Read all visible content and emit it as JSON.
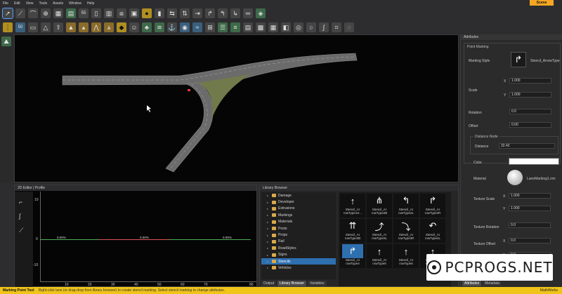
{
  "menubar": {
    "items": [
      "File",
      "Edit",
      "View",
      "Tools",
      "Assets",
      "Window",
      "Help"
    ],
    "scene_badge": "Scene"
  },
  "toolbar_row1_icons": [
    "select-arrow",
    "road-tool",
    "road-curve",
    "road-junction",
    "crosswalk",
    "building",
    "sign-55",
    "sign-blank",
    "barrier",
    "fence",
    "trafficlight-box",
    "trafficlight",
    "bus-stop",
    "arrow-left-right",
    "arrow-up-down",
    "truck",
    "arrow-right",
    "marking-left",
    "marking-right",
    "stop-line",
    "sign-green"
  ],
  "toolbar_row2_icons": [
    "lane-marking",
    "sign-50",
    "speed-hump",
    "triangle-sign",
    "direction-sign",
    "cone",
    "cones",
    "cones-row",
    "traffic-cone-3",
    "barrier-yellow",
    "person",
    "tree",
    "grass",
    "anchor",
    "camera",
    "water",
    "signal-road",
    "stack",
    "layers",
    "book",
    "pattern",
    "ground",
    "object",
    "disc",
    "ring",
    "curve-road",
    "road-mesh",
    "circle-tool"
  ],
  "left_strip": {
    "icon": "terrain-icon"
  },
  "attributes": {
    "panel_title": "Attributes",
    "section": "Point Marking",
    "marking_style_label": "Marking Style",
    "marking_style_value": "Stencil_ArrowType",
    "scale_label": "Scale",
    "scale_x": "1.000",
    "scale_y": "1.000",
    "x_label": "X",
    "y_label": "Y",
    "rotation_label": "Rotation",
    "rotation_value": "0.0",
    "offset_label": "Offset",
    "offset_value": "0.00",
    "distance_node_title": "Distance Node",
    "distance_label": "Distance",
    "distance_value": "32.42",
    "color_label": "Color",
    "material_label": "Material",
    "material_value": "LaneMarking1.rrm",
    "texture_scale_label": "Texture Scale",
    "texture_scale_x": "1.000",
    "texture_scale_y": "1.000",
    "texture_rotation_label": "Texture Rotation",
    "texture_rotation_value": "0.0",
    "texture_offset_label": "Texture Offset",
    "texture_offset_x": "0.0",
    "texture_offset_y": "0.0",
    "tabs": [
      "Attributes",
      "Metadata"
    ]
  },
  "editor2d": {
    "title": "2D Editor | Profile",
    "y_ticks": [
      "10",
      "0",
      "-10"
    ],
    "x_ticks": [
      "10",
      "20",
      "30",
      "40",
      "50",
      "60",
      "70",
      "80"
    ],
    "grade_labels": [
      "0.00%",
      "0.00%",
      "0.00%"
    ]
  },
  "library": {
    "title": "Library Browser",
    "tree": [
      "Damage",
      "Developer",
      "Extrusions",
      "Markings",
      "Materials",
      "Posts",
      "Props",
      "Rail",
      "RoadStyles",
      "Signs",
      "Stencils",
      "Vehicles"
    ],
    "selected_folder": "Stencils",
    "thumbs": [
      {
        "cap": "Stencil_Ar rowType1S...",
        "icon": "arrow-straight"
      },
      {
        "cap": "Stencil_Ar rowType2B",
        "icon": "arrow-fork"
      },
      {
        "cap": "Stencil_Ar rowType2L",
        "icon": "arrow-left"
      },
      {
        "cap": "Stencil_Ar rowType2R",
        "icon": "arrow-right"
      },
      {
        "cap": "Stencil_Ar rowType3B",
        "icon": "arrow-fork"
      },
      {
        "cap": "Stencil_Ar rowType3L",
        "icon": "arrow-bend-left"
      },
      {
        "cap": "Stencil_Ar rowType3R",
        "icon": "arrow-bend-right"
      },
      {
        "cap": "Stencil_Ar rowType4L",
        "icon": "arrow-uturn"
      },
      {
        "cap": "Stencil_Ar rowType4",
        "icon": "arrow-curve-right"
      },
      {
        "cap": "Stencil_Ar rowType5",
        "icon": "arrow-straight"
      },
      {
        "cap": "Stencil_Ar rowType6",
        "icon": "arrow-straight"
      },
      {
        "cap": "Stencil_Ar rowType7",
        "icon": "arrow-straight"
      }
    ],
    "tabs": [
      "Output",
      "Library Browser",
      "Variables"
    ]
  },
  "statusbar": {
    "tool": "Marking Point Tool",
    "hint": "Right-click lane (or drag-drop from library browser) to create stencil marking. Select stencil marking to change attributes.",
    "brand": "MathWorks"
  },
  "watermark": "PCPROGS.NET",
  "colors": {
    "status_yellow": "#f0c419",
    "scene_orange": "#f5a623",
    "select_blue": "#2e6fb0"
  }
}
